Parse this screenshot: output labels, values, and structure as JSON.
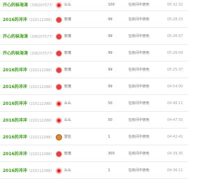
{
  "table": {
    "rows": [
      {
        "nick": "开心的袜海涛",
        "uid": "（206207577）",
        "gift_icon": "lips-icon",
        "gift": "么么",
        "count": "100",
        "status": "在房间中使用",
        "time": "05:32:32"
      },
      {
        "nick": "2016的冲冲",
        "uid": "（210112288）",
        "gift_icon": "rose-icon",
        "gift": "玫瑰",
        "count": "99",
        "status": "在房间中使用",
        "time": "05:28:23"
      },
      {
        "nick": "开心的袜海涛",
        "uid": "（206207577）",
        "gift_icon": "rose-icon",
        "gift": "玫瑰",
        "count": "99",
        "status": "在房间中使用",
        "time": "05:26:57"
      },
      {
        "nick": "开心的袜海涛",
        "uid": "（206207577）",
        "gift_icon": "rose-icon",
        "gift": "玫瑰",
        "count": "99",
        "status": "在房间中使用",
        "time": "05:26:09"
      },
      {
        "nick": "2016的冲冲",
        "uid": "（210112288）",
        "gift_icon": "rose-icon",
        "gift": "玫瑰",
        "count": "99",
        "status": "在房间中使用",
        "time": "05:25:37"
      },
      {
        "nick": "2016的冲冲",
        "uid": "（210112288）",
        "gift_icon": "rose-icon",
        "gift": "玫瑰",
        "count": "99",
        "status": "在房间中使用",
        "time": "04:54:00"
      },
      {
        "nick": "2016的冲冲",
        "uid": "（210112288）",
        "gift_icon": "lips-icon",
        "gift": "么么",
        "count": "50",
        "status": "在房间中使用",
        "time": "04:48:11"
      },
      {
        "nick": "2016的冲冲",
        "uid": "（210112288）",
        "gift_icon": "lips-icon",
        "gift": "么么",
        "count": "50",
        "status": "在房间中使用",
        "time": "04:47:55"
      },
      {
        "nick": "2016的冲冲",
        "uid": "（210112288）",
        "gift_icon": "lion-icon",
        "gift": "雷狂",
        "count": "1",
        "status": "在房间中使用",
        "time": "04:42:41"
      },
      {
        "nick": "2016的冲冲",
        "uid": "（210112288）",
        "gift_icon": "rose-icon",
        "gift": "玫瑰",
        "count": "300",
        "status": "在房间中使用",
        "time": "04:39:30"
      },
      {
        "nick": "2016的冲冲",
        "uid": "（210112288）",
        "gift_icon": "lips-icon",
        "gift": "么么",
        "count": "1",
        "status": "在房间中使用",
        "time": "04:36:11"
      }
    ]
  }
}
